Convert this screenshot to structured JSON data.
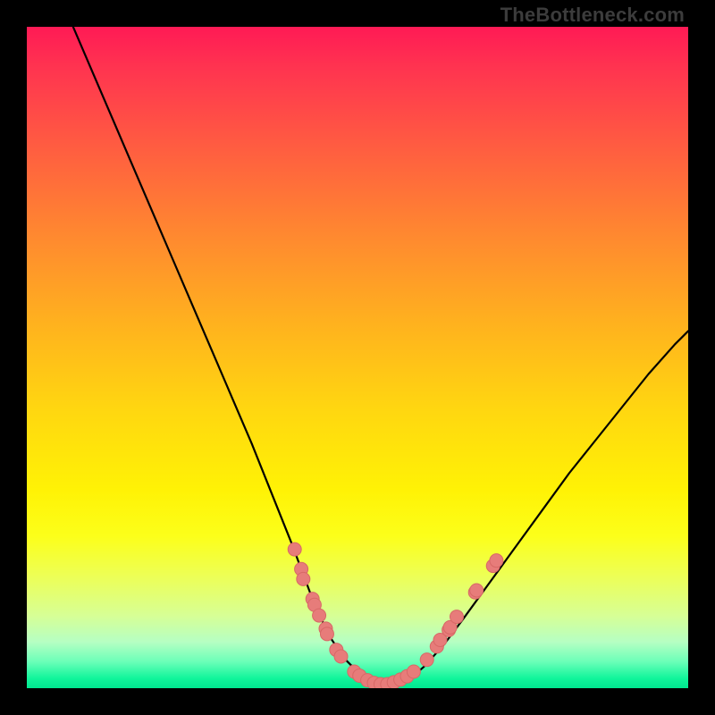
{
  "watermark": "TheBottleneck.com",
  "colors": {
    "frame": "#000000",
    "curve": "#000000",
    "marker_fill": "#e77c7a",
    "marker_stroke": "#d86866"
  },
  "chart_data": {
    "type": "line",
    "title": "",
    "xlabel": "",
    "ylabel": "",
    "xlim": [
      0,
      100
    ],
    "ylim": [
      0,
      100
    ],
    "grid": false,
    "legend": false,
    "series": [
      {
        "name": "bottleneck-curve",
        "x": [
          7,
          10,
          13,
          16,
          19,
          22,
          25,
          28,
          31,
          34,
          36,
          38,
          40,
          41.5,
          43,
          44.5,
          46,
          48,
          50,
          52,
          54,
          56,
          58,
          60,
          63,
          66,
          70,
          74,
          78,
          82,
          86,
          90,
          94,
          98,
          100
        ],
        "y": [
          100,
          93,
          86,
          79,
          72,
          65,
          58,
          51,
          44,
          37,
          32,
          27,
          22,
          18,
          14,
          10.5,
          7.5,
          4.5,
          2.5,
          1.3,
          0.6,
          0.6,
          1.5,
          3.2,
          6.5,
          10.5,
          16,
          21.5,
          27,
          32.5,
          37.5,
          42.5,
          47.5,
          52,
          54
        ]
      }
    ],
    "markers": [
      {
        "x": 40.5,
        "y": 21
      },
      {
        "x": 41.5,
        "y": 18
      },
      {
        "x": 41.8,
        "y": 16.5
      },
      {
        "x": 43.2,
        "y": 13.5
      },
      {
        "x": 43.5,
        "y": 12.6
      },
      {
        "x": 44.2,
        "y": 11
      },
      {
        "x": 45.2,
        "y": 9
      },
      {
        "x": 45.4,
        "y": 8.2
      },
      {
        "x": 46.8,
        "y": 5.8
      },
      {
        "x": 47.5,
        "y": 4.8
      },
      {
        "x": 49.5,
        "y": 2.5
      },
      {
        "x": 50.3,
        "y": 1.9
      },
      {
        "x": 51.5,
        "y": 1.2
      },
      {
        "x": 52.5,
        "y": 0.8
      },
      {
        "x": 53.5,
        "y": 0.6
      },
      {
        "x": 54.5,
        "y": 0.6
      },
      {
        "x": 55.5,
        "y": 0.9
      },
      {
        "x": 56.5,
        "y": 1.3
      },
      {
        "x": 57.5,
        "y": 1.8
      },
      {
        "x": 58.5,
        "y": 2.5
      },
      {
        "x": 60.5,
        "y": 4.3
      },
      {
        "x": 62.0,
        "y": 6.3
      },
      {
        "x": 62.5,
        "y": 7.3
      },
      {
        "x": 63.8,
        "y": 8.8
      },
      {
        "x": 64.0,
        "y": 9.2
      },
      {
        "x": 65.0,
        "y": 10.8
      },
      {
        "x": 67.8,
        "y": 14.5
      },
      {
        "x": 68.0,
        "y": 14.8
      },
      {
        "x": 70.5,
        "y": 18.5
      },
      {
        "x": 71.0,
        "y": 19.3
      }
    ]
  }
}
